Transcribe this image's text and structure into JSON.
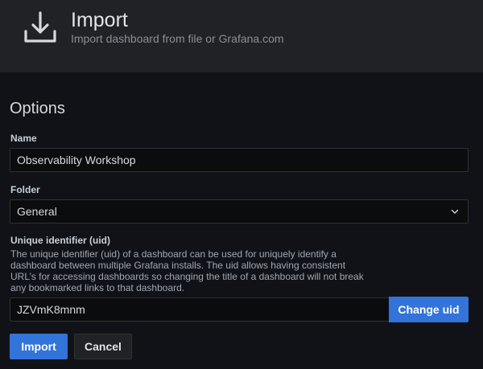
{
  "header": {
    "title": "Import",
    "subtitle": "Import dashboard from file or Grafana.com",
    "icon": "download-icon"
  },
  "options": {
    "title": "Options",
    "name": {
      "label": "Name",
      "value": "Observability Workshop"
    },
    "folder": {
      "label": "Folder",
      "value": "General"
    },
    "uid": {
      "label": "Unique identifier (uid)",
      "description": "The unique identifier (uid) of a dashboard can be used for uniquely identify a dashboard between multiple Grafana installs. The uid allows having consistent URL’s for accessing dashboards so changing the title of a dashboard will not break any bookmarked links to that dashboard.",
      "value": "JZVmK8mnm",
      "change_label": "Change uid"
    }
  },
  "actions": {
    "import_label": "Import",
    "cancel_label": "Cancel"
  },
  "colors": {
    "primary": "#3274d9",
    "background": "#111217",
    "header_bg": "#202226"
  }
}
